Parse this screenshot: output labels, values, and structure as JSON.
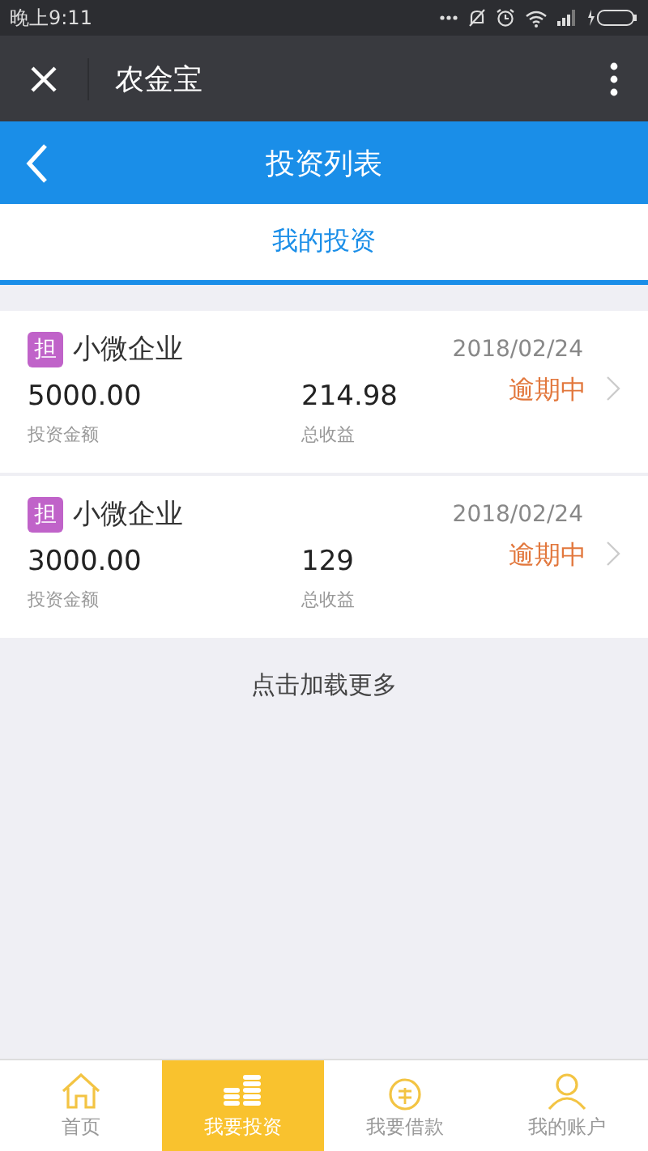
{
  "status_bar": {
    "time": "晚上9:11"
  },
  "app_bar": {
    "title": "农金宝"
  },
  "header": {
    "title": "投资列表"
  },
  "tabs": [
    {
      "label": "我的投资",
      "selected": true
    }
  ],
  "investments": [
    {
      "badge": "担",
      "name": "小微企业",
      "date": "2018/02/24",
      "amount": "5000.00",
      "amount_label": "投资金额",
      "earnings": "214.98",
      "earnings_label": "总收益",
      "status": "逾期中"
    },
    {
      "badge": "担",
      "name": "小微企业",
      "date": "2018/02/24",
      "amount": "3000.00",
      "amount_label": "投资金额",
      "earnings": "129",
      "earnings_label": "总收益",
      "status": "逾期中"
    }
  ],
  "load_more": "点击加载更多",
  "bottom_nav": [
    {
      "kind": "home",
      "label": "首页",
      "selected": false
    },
    {
      "kind": "coins",
      "label": "我要投资",
      "selected": true
    },
    {
      "kind": "loan",
      "label": "我要借款",
      "selected": false
    },
    {
      "kind": "account",
      "label": "我的账户",
      "selected": false
    }
  ]
}
